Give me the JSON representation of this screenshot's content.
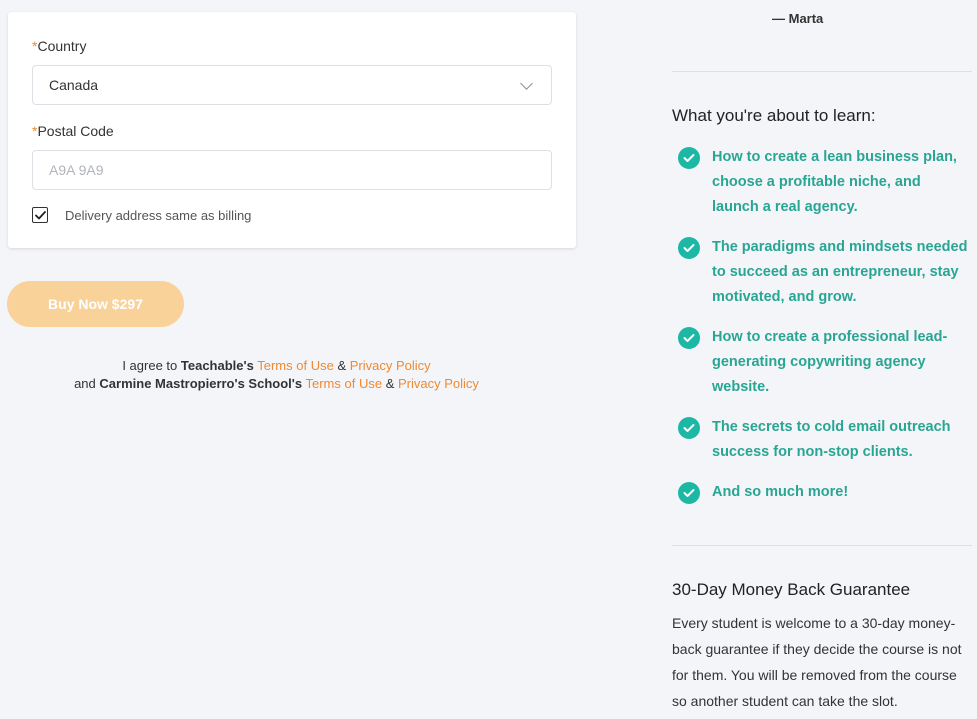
{
  "form": {
    "country_label": "Country",
    "country_value": "Canada",
    "postal_label": "Postal Code",
    "postal_placeholder": "A9A 9A9",
    "required_marker": "*",
    "delivery_checkbox_label": "Delivery address same as billing",
    "delivery_checked": true
  },
  "buy_button": {
    "label": "Buy Now $297"
  },
  "agreement": {
    "line1_prefix": "I agree to",
    "line1_org": "Teachable's",
    "terms": "Terms of Use",
    "amp": "&",
    "privacy": "Privacy Policy",
    "line2_prefix": "and",
    "line2_org": "Carmine Mastropierro's School's"
  },
  "testimonial": {
    "author": "— Marta"
  },
  "learn": {
    "title": "What you're about to learn:",
    "items": [
      "How to create a lean business plan, choose a profitable niche, and launch a real agency.",
      "The paradigms and mindsets needed to succeed as an entrepreneur, stay motivated, and grow.",
      "How to create a professional lead-generating copywriting agency website.",
      "The secrets to cold email outreach success for non-stop clients.",
      "And so much more!"
    ]
  },
  "guarantee": {
    "title": "30-Day Money Back Guarantee",
    "body": "Every student is welcome to a 30-day money-back guarantee if they decide the course is not for them. You will be removed from the course so another student can take the slot."
  },
  "colors": {
    "accent_orange": "#f0892f",
    "button_bg": "#f9d29a",
    "check_teal": "#1cb8a5",
    "learn_text_teal": "#29a594"
  },
  "icons": {
    "select_arrow": "chevron-down-icon",
    "checkbox_mark": "checkmark-icon",
    "list_bullet": "check-circle-icon"
  }
}
